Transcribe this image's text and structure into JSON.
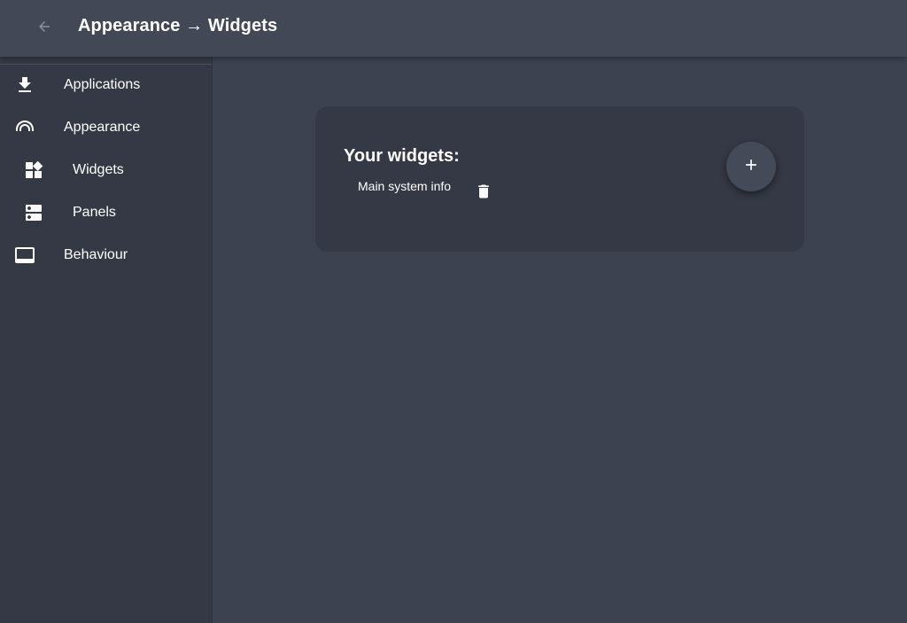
{
  "header": {
    "back_icon": "arrow-left-icon",
    "title": "Appearance → Widgets"
  },
  "sidebar": {
    "items": [
      {
        "label": "Applications",
        "icon": "download-icon"
      },
      {
        "label": "Appearance",
        "icon": "rainbow-icon"
      },
      {
        "label": "Widgets",
        "icon": "widgets-icon"
      },
      {
        "label": "Panels",
        "icon": "panels-icon"
      },
      {
        "label": "Behaviour",
        "icon": "dock-icon"
      }
    ]
  },
  "main": {
    "card_title": "Your widgets:",
    "widgets": [
      {
        "name": "Main system info",
        "action_icon": "trash-icon"
      }
    ],
    "add_icon": "plus-icon"
  },
  "colors": {
    "background": "#3d4250",
    "header": "#434857",
    "sidebar": "#353945",
    "card": "#353945",
    "text": "#ffffff",
    "muted_icon": "#8a8f9c"
  }
}
